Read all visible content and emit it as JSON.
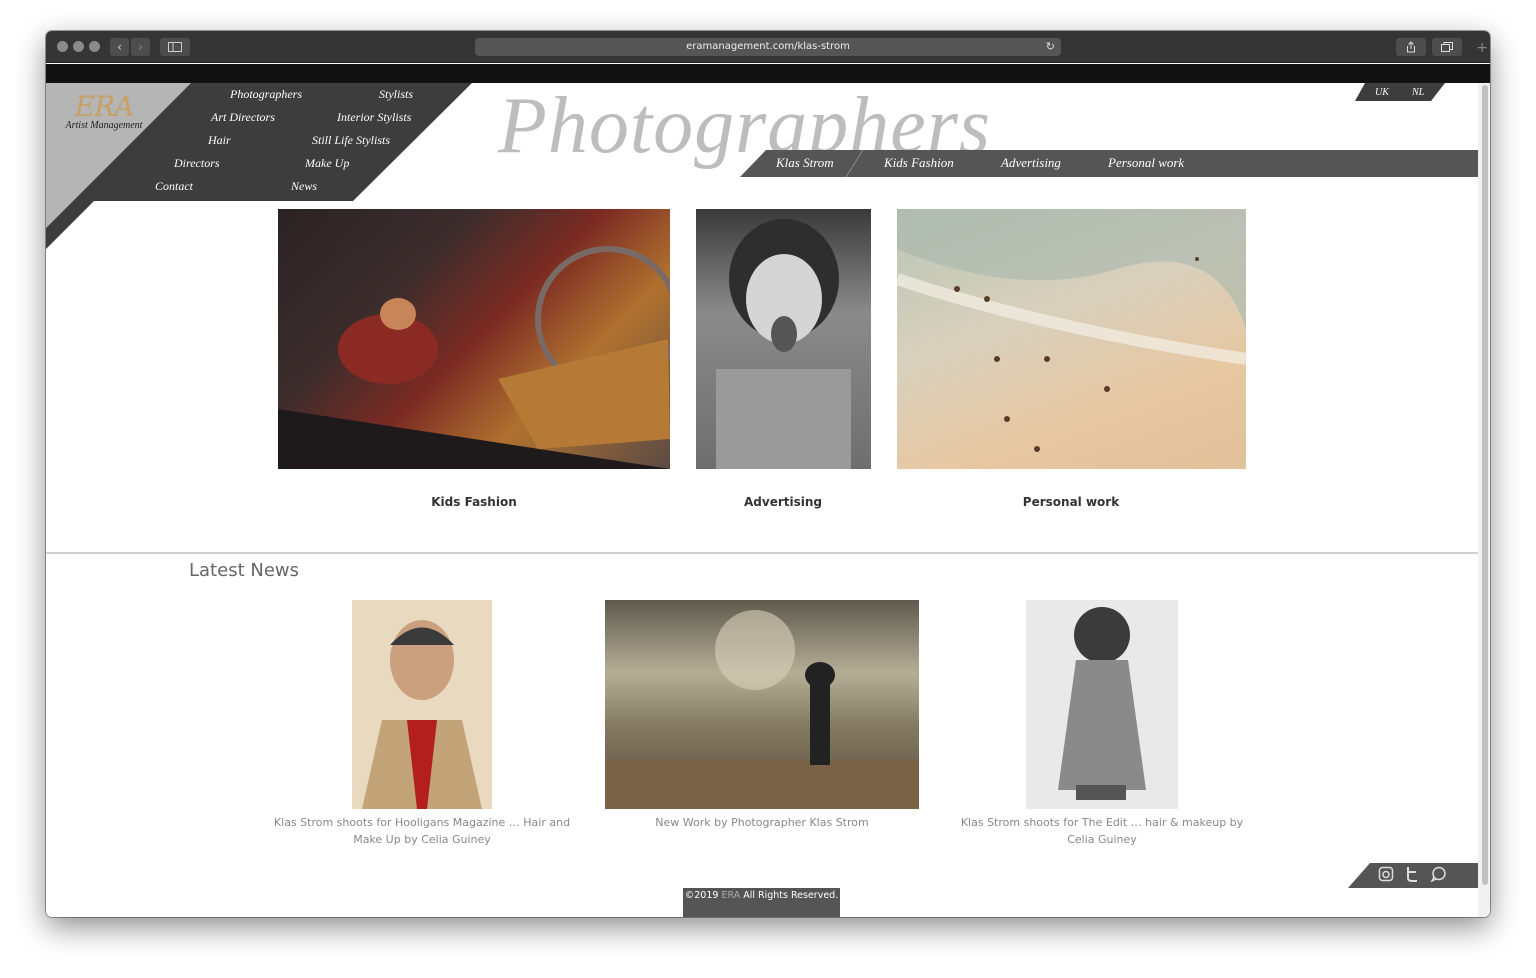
{
  "browser": {
    "url": "eramanagement.com/klas-strom",
    "back_glyph": "‹",
    "forward_glyph": "›",
    "reload_glyph": "↻",
    "new_tab_glyph": "+"
  },
  "logo": {
    "name": "ERA",
    "sub": "Artist Management"
  },
  "menu": {
    "photographers": "Photographers",
    "stylists": "Stylists",
    "art_directors": "Art Directors",
    "interior_stylists": "Interior Stylists",
    "hair": "Hair",
    "still_life_stylists": "Still Life Stylists",
    "directors": "Directors",
    "make_up": "Make Up",
    "contact": "Contact",
    "news": "News"
  },
  "page_title": "Photographers",
  "languages": [
    "UK",
    "NL"
  ],
  "subnav": [
    "Klas Strom",
    "Kids Fashion",
    "Advertising",
    "Personal work"
  ],
  "categories": [
    {
      "label": "Kids Fashion"
    },
    {
      "label": "Advertising"
    },
    {
      "label": "Personal work"
    }
  ],
  "news": {
    "heading": "Latest News",
    "items": [
      {
        "caption": "Klas Strom shoots for Hooligans Magazine … Hair and Make Up by Celia Guiney"
      },
      {
        "caption": "New Work by Photographer Klas Strom"
      },
      {
        "caption": "Klas Strom shoots for The Edit … hair & makeup by Celia Guiney"
      }
    ]
  },
  "social": [
    "instagram-icon",
    "twitter-icon",
    "chat-icon"
  ],
  "footer": {
    "prefix": "©2019 ",
    "brand": "ERA",
    "suffix": " All Rights Reserved."
  },
  "colors": {
    "nav_dark": "#3d3d3d",
    "nav_grey": "#b5b5b5",
    "logo_gold": "#c7a067",
    "title_grey": "#bdbdbd"
  }
}
